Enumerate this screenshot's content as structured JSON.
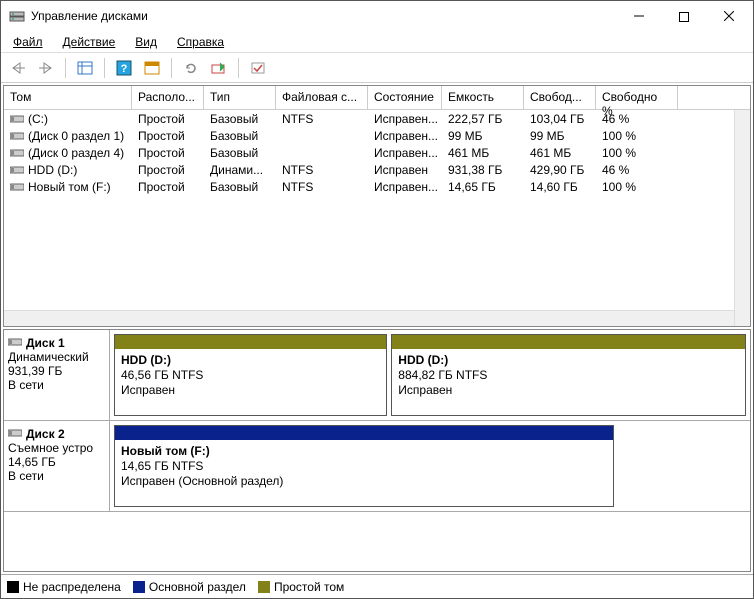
{
  "title": "Управление дисками",
  "menubar": {
    "file": "Файл",
    "action": "Действие",
    "view": "Вид",
    "help": "Справка"
  },
  "columns": [
    "Том",
    "Располо...",
    "Тип",
    "Файловая с...",
    "Состояние",
    "Емкость",
    "Свобод...",
    "Свободно %"
  ],
  "rows": [
    [
      "(C:)",
      "Простой",
      "Базовый",
      "NTFS",
      "Исправен...",
      "222,57 ГБ",
      "103,04 ГБ",
      "46 %"
    ],
    [
      "(Диск 0 раздел 1)",
      "Простой",
      "Базовый",
      "",
      "Исправен...",
      "99 МБ",
      "99 МБ",
      "100 %"
    ],
    [
      "(Диск 0 раздел 4)",
      "Простой",
      "Базовый",
      "",
      "Исправен...",
      "461 МБ",
      "461 МБ",
      "100 %"
    ],
    [
      "HDD (D:)",
      "Простой",
      "Динами...",
      "NTFS",
      "Исправен",
      "931,38 ГБ",
      "429,90 ГБ",
      "46 %"
    ],
    [
      "Новый том (F:)",
      "Простой",
      "Базовый",
      "NTFS",
      "Исправен...",
      "14,65 ГБ",
      "14,60 ГБ",
      "100 %"
    ]
  ],
  "disks": [
    {
      "name": "Диск 1",
      "type": "Динамический",
      "size": "931,39 ГБ",
      "status": "В сети",
      "parts": [
        {
          "title": "HDD  (D:)",
          "sub": "46,56 ГБ NTFS",
          "status": "Исправен",
          "color": "#828219",
          "flex": 1
        },
        {
          "title": "HDD  (D:)",
          "sub": "884,82 ГБ NTFS",
          "status": "Исправен",
          "color": "#828219",
          "flex": 1.3
        }
      ]
    },
    {
      "name": "Диск 2",
      "type": "Съемное устро",
      "size": "14,65 ГБ",
      "status": "В сети",
      "parts": [
        {
          "title": "Новый том  (F:)",
          "sub": "14,65 ГБ NTFS",
          "status": "Исправен (Основной раздел)",
          "color": "#0a238c",
          "flex": 1,
          "fixedWidth": 500
        }
      ]
    }
  ],
  "legend": [
    {
      "label": "Не распределена",
      "color": "#000"
    },
    {
      "label": "Основной раздел",
      "color": "#0a238c"
    },
    {
      "label": "Простой том",
      "color": "#828219"
    }
  ]
}
